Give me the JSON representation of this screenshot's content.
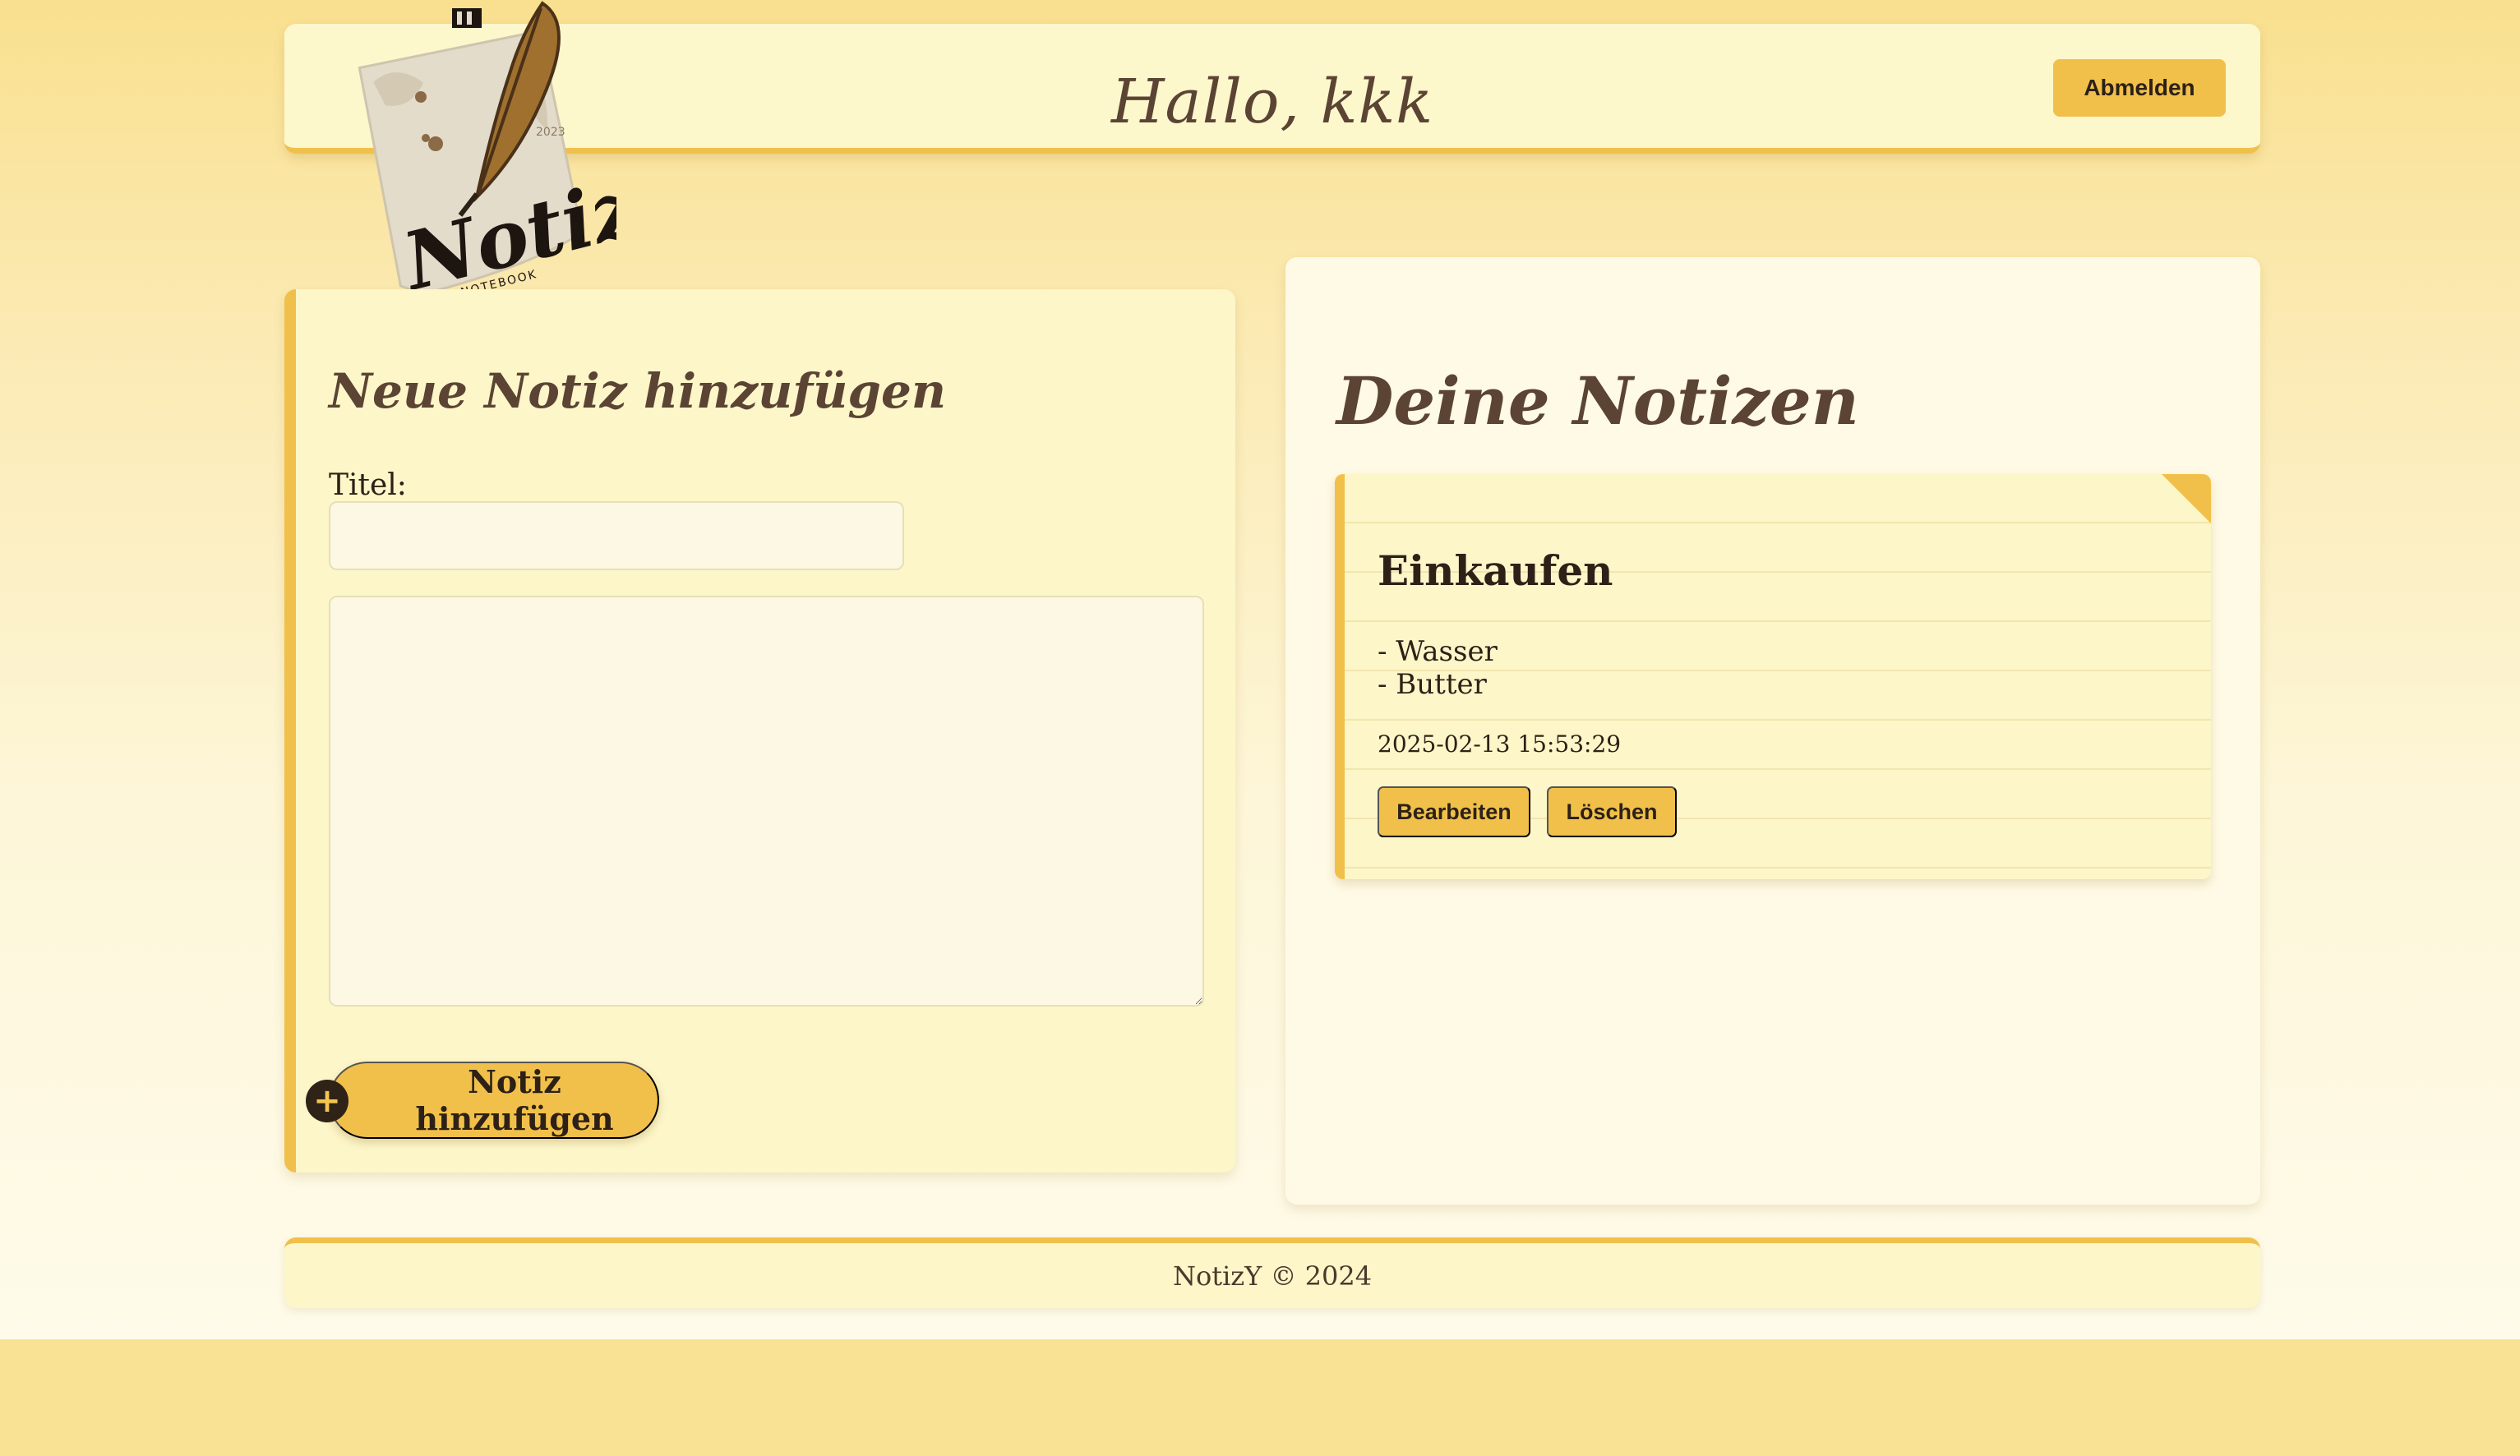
{
  "header": {
    "greeting": "Hallo, kkk",
    "logout_label": "Abmelden"
  },
  "logo": {
    "brand": "Notizy",
    "subtitle": "NOTEBOOK",
    "year": "2023"
  },
  "add_form": {
    "heading": "Neue Notiz hinzufügen",
    "title_label": "Titel:",
    "title_value": "",
    "content_value": "",
    "submit_label": "Notiz hinzufügen",
    "submit_icon": "plus-icon"
  },
  "notes_section": {
    "heading": "Deine Notizen",
    "notes": [
      {
        "title": "Einkaufen",
        "content": "- Wasser\n- Butter",
        "date": "2025-02-13 15:53:29",
        "edit_label": "Bearbeiten",
        "delete_label": "Löschen"
      }
    ]
  },
  "footer": {
    "text": "NotizY © 2024"
  },
  "colors": {
    "accent": "#f1c04a",
    "background": "#f9e293",
    "card": "#fdf6c9",
    "text": "#2d2117"
  }
}
